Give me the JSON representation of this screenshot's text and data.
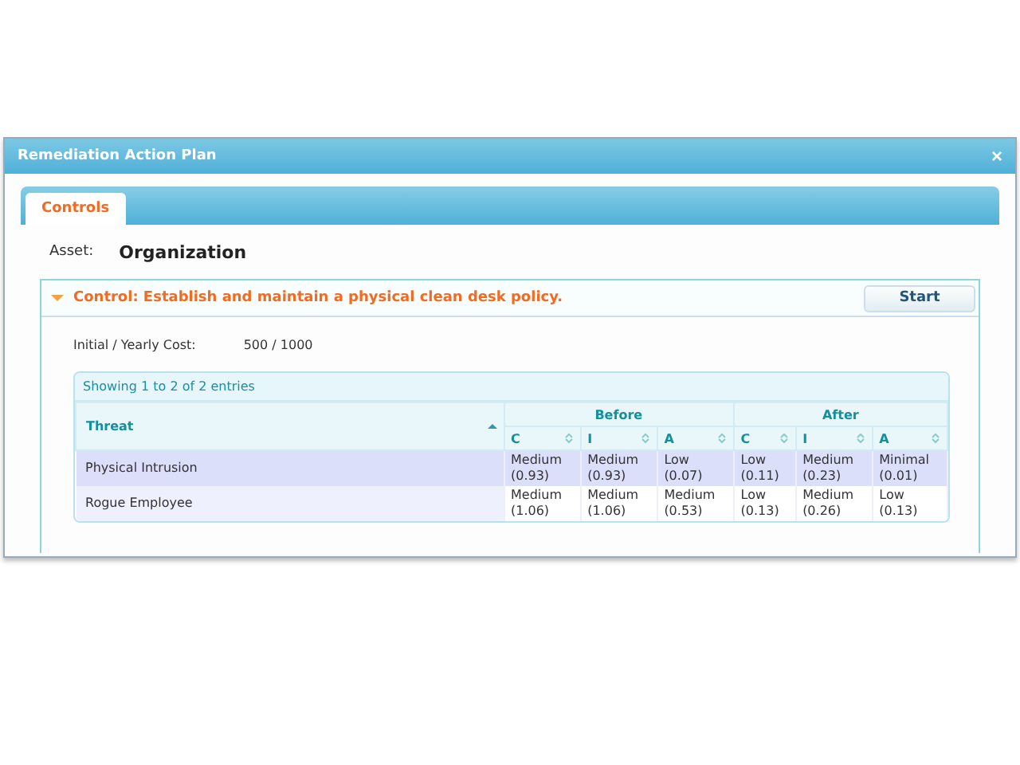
{
  "window": {
    "title": "Remediation Action Plan",
    "close": "×"
  },
  "tabs": [
    {
      "label": "Controls",
      "selected": true
    }
  ],
  "asset": {
    "label": "Asset:",
    "value": "Organization"
  },
  "control": {
    "title": "Control: Establish and maintain a physical clean desk policy.",
    "expanded": true,
    "button": "Start",
    "cost": {
      "label": "Initial / Yearly Cost:",
      "value": "500 / 1000"
    },
    "table": {
      "info": "Showing 1 to 2 of 2 entries",
      "first_column": {
        "label": "Threat",
        "sorted": true
      },
      "groups": [
        {
          "label": "Before",
          "columns": [
            {
              "label": "C",
              "sorted": false
            },
            {
              "label": "I",
              "sorted": false
            },
            {
              "label": "A",
              "sorted": false
            }
          ]
        },
        {
          "label": "After",
          "columns": [
            {
              "label": "C",
              "sorted": false
            },
            {
              "label": "I",
              "sorted": false
            },
            {
              "label": "A",
              "sorted": false
            }
          ]
        }
      ],
      "rows": [
        {
          "threat": "Physical Intrusion",
          "selected": true,
          "cells": [
            [
              "Medium",
              "(0.93)"
            ],
            [
              "Medium",
              "(0.93)"
            ],
            [
              "Low",
              "(0.07)"
            ],
            [
              "Low",
              "(0.11)"
            ],
            [
              "Medium",
              "(0.23)"
            ],
            [
              "Minimal",
              "(0.01)"
            ]
          ]
        },
        {
          "threat": "Rogue Employee",
          "selected": false,
          "cells": [
            [
              "Medium",
              "(1.06)"
            ],
            [
              "Medium",
              "(1.06)"
            ],
            [
              "Medium",
              "(0.53)"
            ],
            [
              "Low",
              "(0.13)"
            ],
            [
              "Medium",
              "(0.26)"
            ],
            [
              "Low",
              "(0.13)"
            ]
          ]
        }
      ]
    }
  }
}
